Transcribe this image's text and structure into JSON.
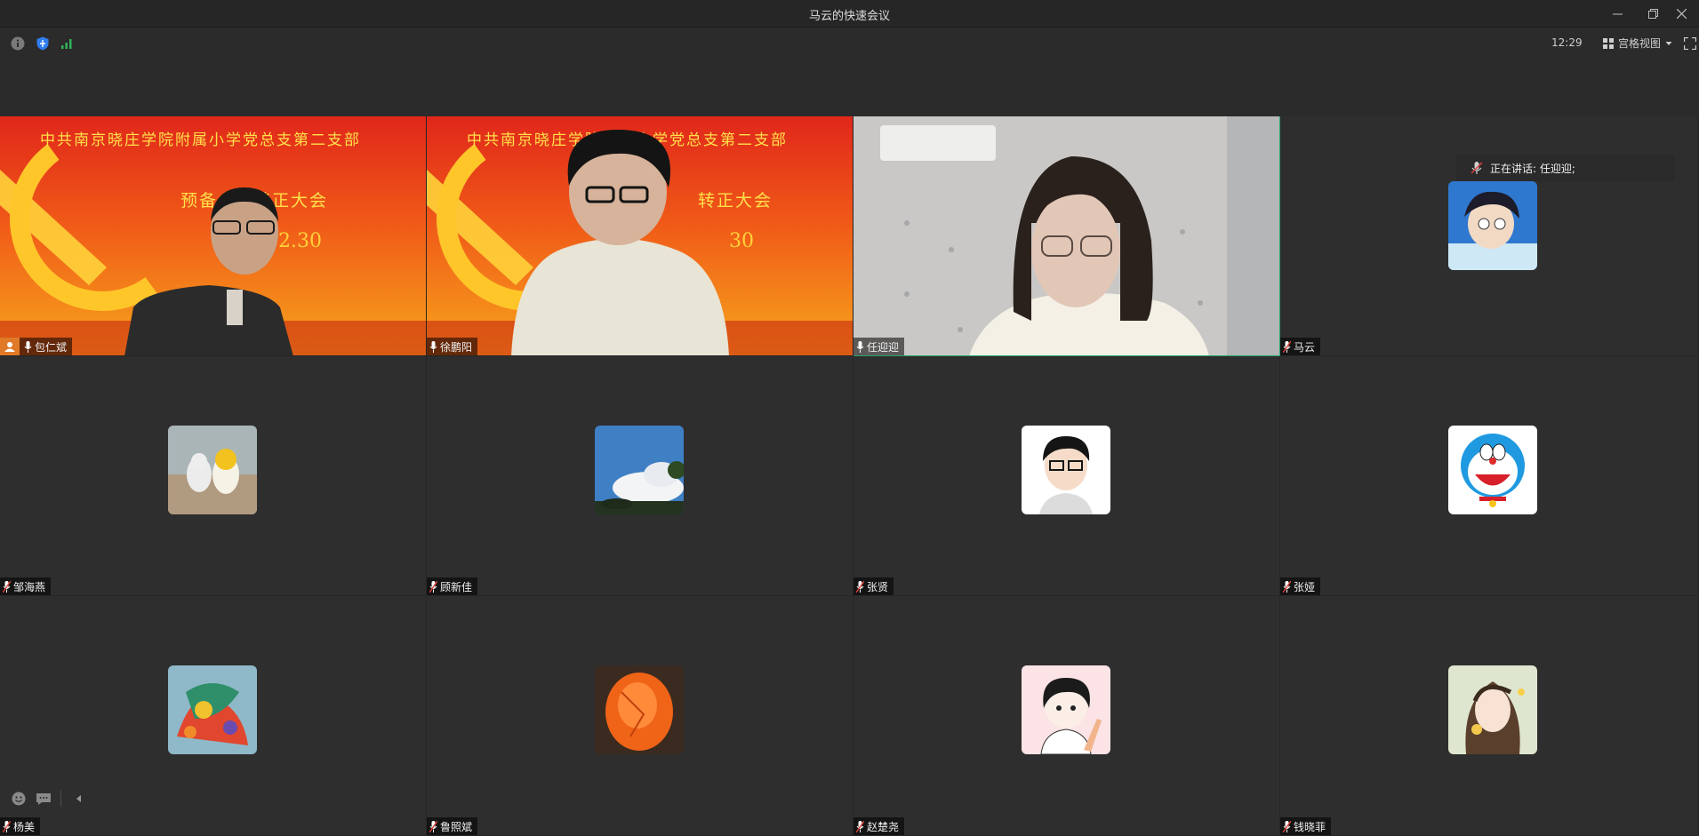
{
  "window": {
    "title": "马云的快速会议"
  },
  "toolbar": {
    "time": "12:29",
    "view_label": "宫格视图"
  },
  "speaking": {
    "label": "正在讲话: 任迎迎;"
  },
  "banner": {
    "title": "中共南京晓庄学院附属小学党总支第二支部",
    "subtitle_a": "预备",
    "subtitle_b": "转正大会",
    "date_a": "2.30",
    "date_b": "30"
  },
  "participants": [
    {
      "name": "包仁斌",
      "kind": "video"
    },
    {
      "name": "徐鹏阳",
      "kind": "video"
    },
    {
      "name": "任迎迎",
      "kind": "video"
    },
    {
      "name": "马云",
      "kind": "avatar"
    },
    {
      "name": "邹海燕",
      "kind": "avatar"
    },
    {
      "name": "顾新佳",
      "kind": "avatar"
    },
    {
      "name": "张贤",
      "kind": "avatar"
    },
    {
      "name": "张娅",
      "kind": "avatar"
    },
    {
      "name": "杨美",
      "kind": "avatar"
    },
    {
      "name": "鲁照斌",
      "kind": "avatar"
    },
    {
      "name": "赵楚尧",
      "kind": "avatar"
    },
    {
      "name": "钱晓菲",
      "kind": "avatar"
    }
  ]
}
